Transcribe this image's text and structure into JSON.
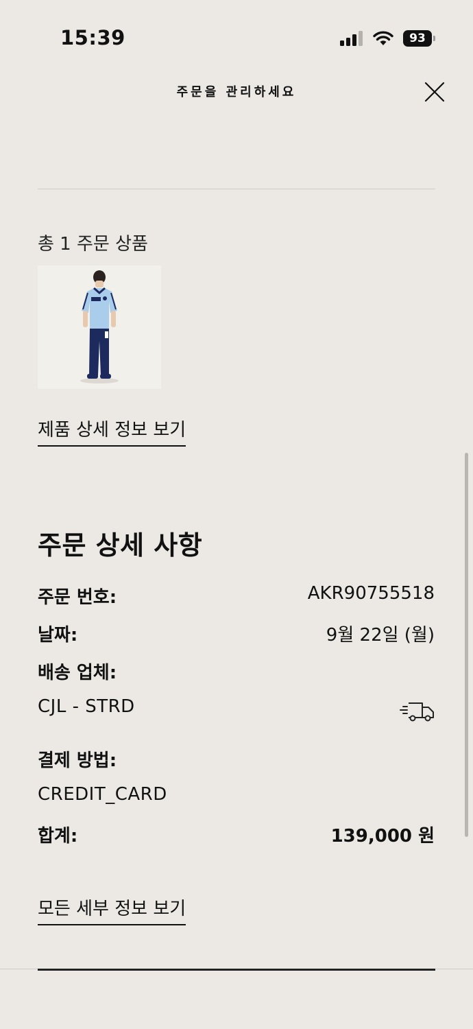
{
  "status_bar": {
    "time": "15:39",
    "battery": "93",
    "icons": [
      "cellular-signal-icon",
      "wifi-icon",
      "battery-icon"
    ]
  },
  "header": {
    "title": "주문을 관리하세요",
    "close_icon": "close-icon"
  },
  "items": {
    "count_label": "총 1 주문 상품",
    "product_image": "product-image",
    "details_link": "제품 상세 정보 보기"
  },
  "order_details": {
    "title": "주문 상세 사항",
    "order_number_label": "주문 번호:",
    "order_number": "AKR90755518",
    "date_label": "날짜:",
    "date": "9월 22일 (월)",
    "carrier_label": "배송 업체:",
    "carrier": "CJL - STRD",
    "carrier_icon": "delivery-truck-icon",
    "payment_label": "결제 방법:",
    "payment": "CREDIT_CARD",
    "total_label": "합계:",
    "total": "139,000 원",
    "all_details_link": "모든 세부 정보 보기"
  },
  "colors": {
    "background": "#ECE9E5",
    "text": "#111111",
    "divider": "#CFCBC6",
    "jersey_blue": "#A9CDEB",
    "pants_navy": "#1C2A5E"
  }
}
